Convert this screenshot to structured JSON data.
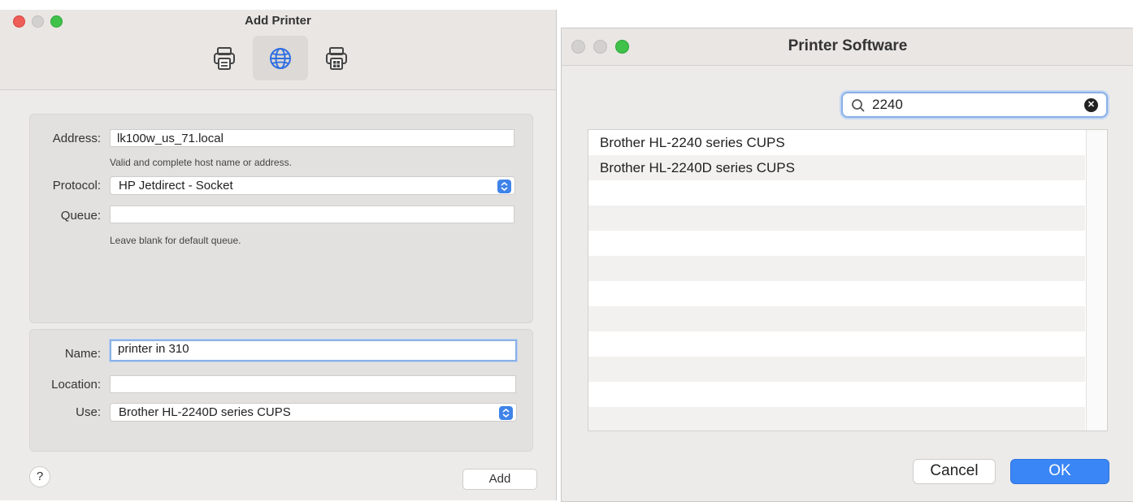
{
  "add_printer": {
    "title": "Add Printer",
    "toolbar": [
      {
        "icon": "printer-icon",
        "selected": false
      },
      {
        "icon": "globe-icon",
        "selected": true
      },
      {
        "icon": "windows-printer-icon",
        "selected": false
      }
    ],
    "address_label": "Address:",
    "address_value": "lk100w_us_71.local",
    "address_hint": "Valid and complete host name or address.",
    "protocol_label": "Protocol:",
    "protocol_value": "HP Jetdirect - Socket",
    "queue_label": "Queue:",
    "queue_value": "",
    "queue_hint": "Leave blank for default queue.",
    "name_label": "Name:",
    "name_value": "printer in 310",
    "location_label": "Location:",
    "location_value": "",
    "use_label": "Use:",
    "use_value": "Brother HL-2240D series CUPS",
    "help_label": "?",
    "add_label": "Add"
  },
  "printer_software": {
    "title": "Printer Software",
    "search_value": "2240",
    "results": [
      "Brother HL-2240 series CUPS",
      "Brother HL-2240D series CUPS"
    ],
    "empty_rows": 10,
    "cancel_label": "Cancel",
    "ok_label": "OK"
  },
  "colors": {
    "accent": "#3b86f7",
    "close": "#ee5d58",
    "zoom": "#3fc14a"
  }
}
